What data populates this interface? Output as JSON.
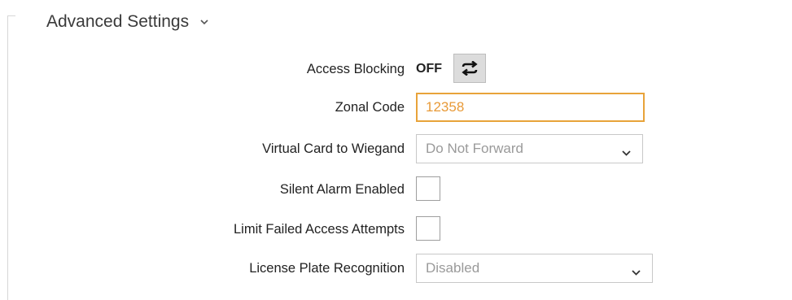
{
  "section": {
    "title": "Advanced Settings",
    "chevron_icon": "chevron-down-icon"
  },
  "fields": {
    "access_blocking": {
      "label": "Access Blocking",
      "state": "OFF",
      "toggle_icon": "swap-arrows-icon"
    },
    "zonal_code": {
      "label": "Zonal Code",
      "value": "12358"
    },
    "virtual_card_to_wiegand": {
      "label": "Virtual Card to Wiegand",
      "selected": "Do Not Forward"
    },
    "silent_alarm_enabled": {
      "label": "Silent Alarm Enabled",
      "checked": false
    },
    "limit_failed_access_attempts": {
      "label": "Limit Failed Access Attempts",
      "checked": false
    },
    "license_plate_recognition": {
      "label": "License Plate Recognition",
      "selected": "Disabled"
    }
  },
  "colors": {
    "accent_orange": "#e8a33a",
    "label_text": "#222222",
    "placeholder_gray": "#9a9a9a"
  }
}
